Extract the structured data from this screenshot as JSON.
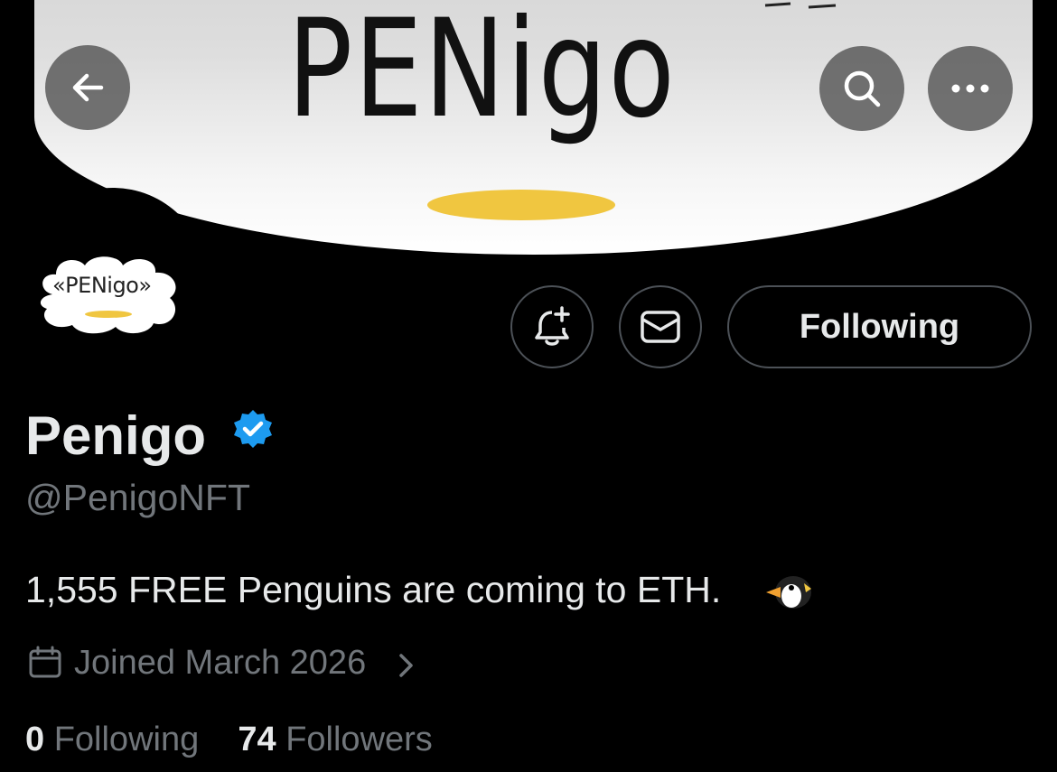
{
  "banner": {
    "logo_text": "PENigo",
    "logo_accent_color": "#f0c640"
  },
  "top_actions": {
    "back_icon": "arrow-left-icon",
    "search_icon": "search-icon",
    "more_icon": "more-horizontal-icon"
  },
  "avatar": {
    "logo_text": "«PENigo»"
  },
  "profile_actions": {
    "notify_icon": "bell-plus-icon",
    "message_icon": "envelope-icon",
    "follow_label": "Following"
  },
  "profile": {
    "name": "Penigo",
    "verified_color": "#1d9bf0",
    "handle": "@PenigoNFT",
    "bio": "1,555 FREE Penguins are coming to ETH.",
    "bio_emoji": "penguin-emoji",
    "joined": "Joined March 2026",
    "following_count": "0",
    "following_label": "Following",
    "followers_count": "74",
    "followers_label": "Followers"
  }
}
